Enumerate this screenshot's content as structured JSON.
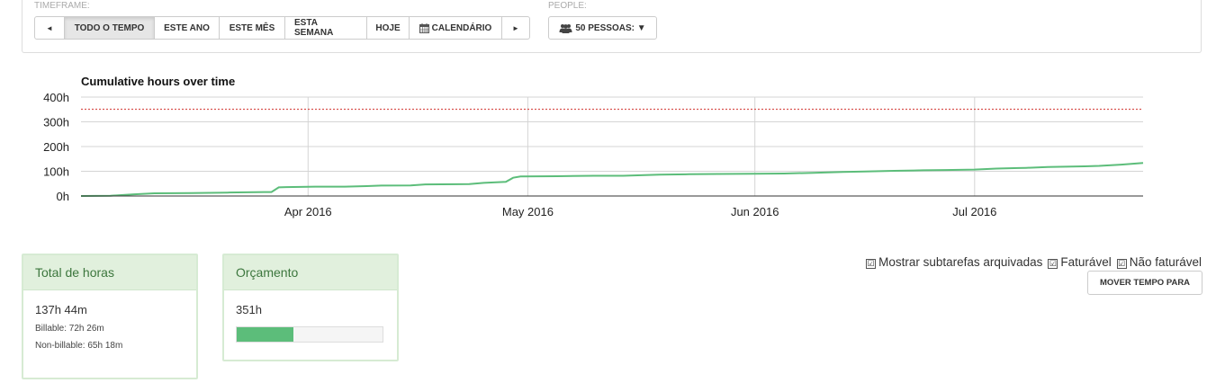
{
  "timeframe": {
    "label": "TIMEFRAME:",
    "buttons": [
      {
        "label": "◄",
        "icon": "prev-icon"
      },
      {
        "label": "TODO O TEMPO",
        "active": true
      },
      {
        "label": "ESTE ANO"
      },
      {
        "label": "ESTE MÊS"
      },
      {
        "label": "ESTA SEMANA"
      },
      {
        "label": "HOJE"
      },
      {
        "label": "CALENDÁRIO",
        "icon": "calendar-icon"
      },
      {
        "label": "►",
        "icon": "next-icon"
      }
    ]
  },
  "people": {
    "label": "PEOPLE:",
    "button_label": "50 PESSOAS: ▼",
    "icon": "users-icon"
  },
  "chart_data": {
    "type": "line",
    "title": "Cumulative hours over time",
    "xlabel": "",
    "ylabel": "",
    "ylim": [
      0,
      400
    ],
    "yticks": [
      "0h",
      "100h",
      "200h",
      "300h",
      "400h"
    ],
    "xlim": [
      "2016-03-01",
      "2016-07-24"
    ],
    "xticks": [
      {
        "date": "2016-04-01",
        "label": "Apr 2016"
      },
      {
        "date": "2016-05-01",
        "label": "May 2016"
      },
      {
        "date": "2016-06-01",
        "label": "Jun 2016"
      },
      {
        "date": "2016-07-01",
        "label": "Jul 2016"
      }
    ],
    "budget_line": 351,
    "budget_color": "#d9534f",
    "line_color": "#5cbd7a",
    "grid": true,
    "series": [
      {
        "points": [
          [
            "2016-03-01",
            0
          ],
          [
            "2016-03-05",
            1
          ],
          [
            "2016-03-08",
            6
          ],
          [
            "2016-03-11",
            11
          ],
          [
            "2016-03-16",
            12
          ],
          [
            "2016-03-21",
            14
          ],
          [
            "2016-03-26",
            16
          ],
          [
            "2016-03-27",
            16
          ],
          [
            "2016-03-28",
            35
          ],
          [
            "2016-03-29",
            36
          ],
          [
            "2016-04-02",
            38
          ],
          [
            "2016-04-06",
            38
          ],
          [
            "2016-04-09",
            40
          ],
          [
            "2016-04-11",
            42
          ],
          [
            "2016-04-15",
            43
          ],
          [
            "2016-04-17",
            47
          ],
          [
            "2016-04-23",
            48
          ],
          [
            "2016-04-25",
            53
          ],
          [
            "2016-04-28",
            57
          ],
          [
            "2016-04-29",
            74
          ],
          [
            "2016-04-30",
            79
          ],
          [
            "2016-05-05",
            80
          ],
          [
            "2016-05-10",
            82
          ],
          [
            "2016-05-14",
            82
          ],
          [
            "2016-05-19",
            86
          ],
          [
            "2016-05-23",
            88
          ],
          [
            "2016-05-27",
            89
          ],
          [
            "2016-06-01",
            90
          ],
          [
            "2016-06-05",
            91
          ],
          [
            "2016-06-09",
            94
          ],
          [
            "2016-06-13",
            97
          ],
          [
            "2016-06-16",
            99
          ],
          [
            "2016-06-20",
            102
          ],
          [
            "2016-06-24",
            104
          ],
          [
            "2016-06-27",
            105
          ],
          [
            "2016-07-01",
            107
          ],
          [
            "2016-07-04",
            111
          ],
          [
            "2016-07-07",
            113
          ],
          [
            "2016-07-08",
            114
          ],
          [
            "2016-07-11",
            117
          ],
          [
            "2016-07-16",
            120
          ],
          [
            "2016-07-18",
            122
          ],
          [
            "2016-07-21",
            127
          ],
          [
            "2016-07-24",
            134
          ],
          [
            "2016-07-27",
            137
          ],
          [
            "2016-07-30",
            138
          ],
          [
            "2016-08-02",
            140
          ],
          [
            "2016-08-04",
            142
          ],
          [
            "2016-08-06",
            144
          ],
          [
            "2016-08-08",
            150
          ]
        ]
      }
    ]
  },
  "total_card": {
    "title": "Total de horas",
    "total": "137h 44m",
    "billable": "Billable: 72h 26m",
    "nonbillable": "Non-billable: 65h 18m"
  },
  "budget_card": {
    "title": "Orçamento",
    "value": "351h",
    "progress_fraction": 0.39,
    "progress_color": "#5cbd7a"
  },
  "options": {
    "archived": "Mostrar subtarefas arquivadas",
    "billable": "Faturável",
    "nonbillable": "Não faturável",
    "check_glyph": "☑"
  },
  "move_button": "MOVER TEMPO PARA"
}
